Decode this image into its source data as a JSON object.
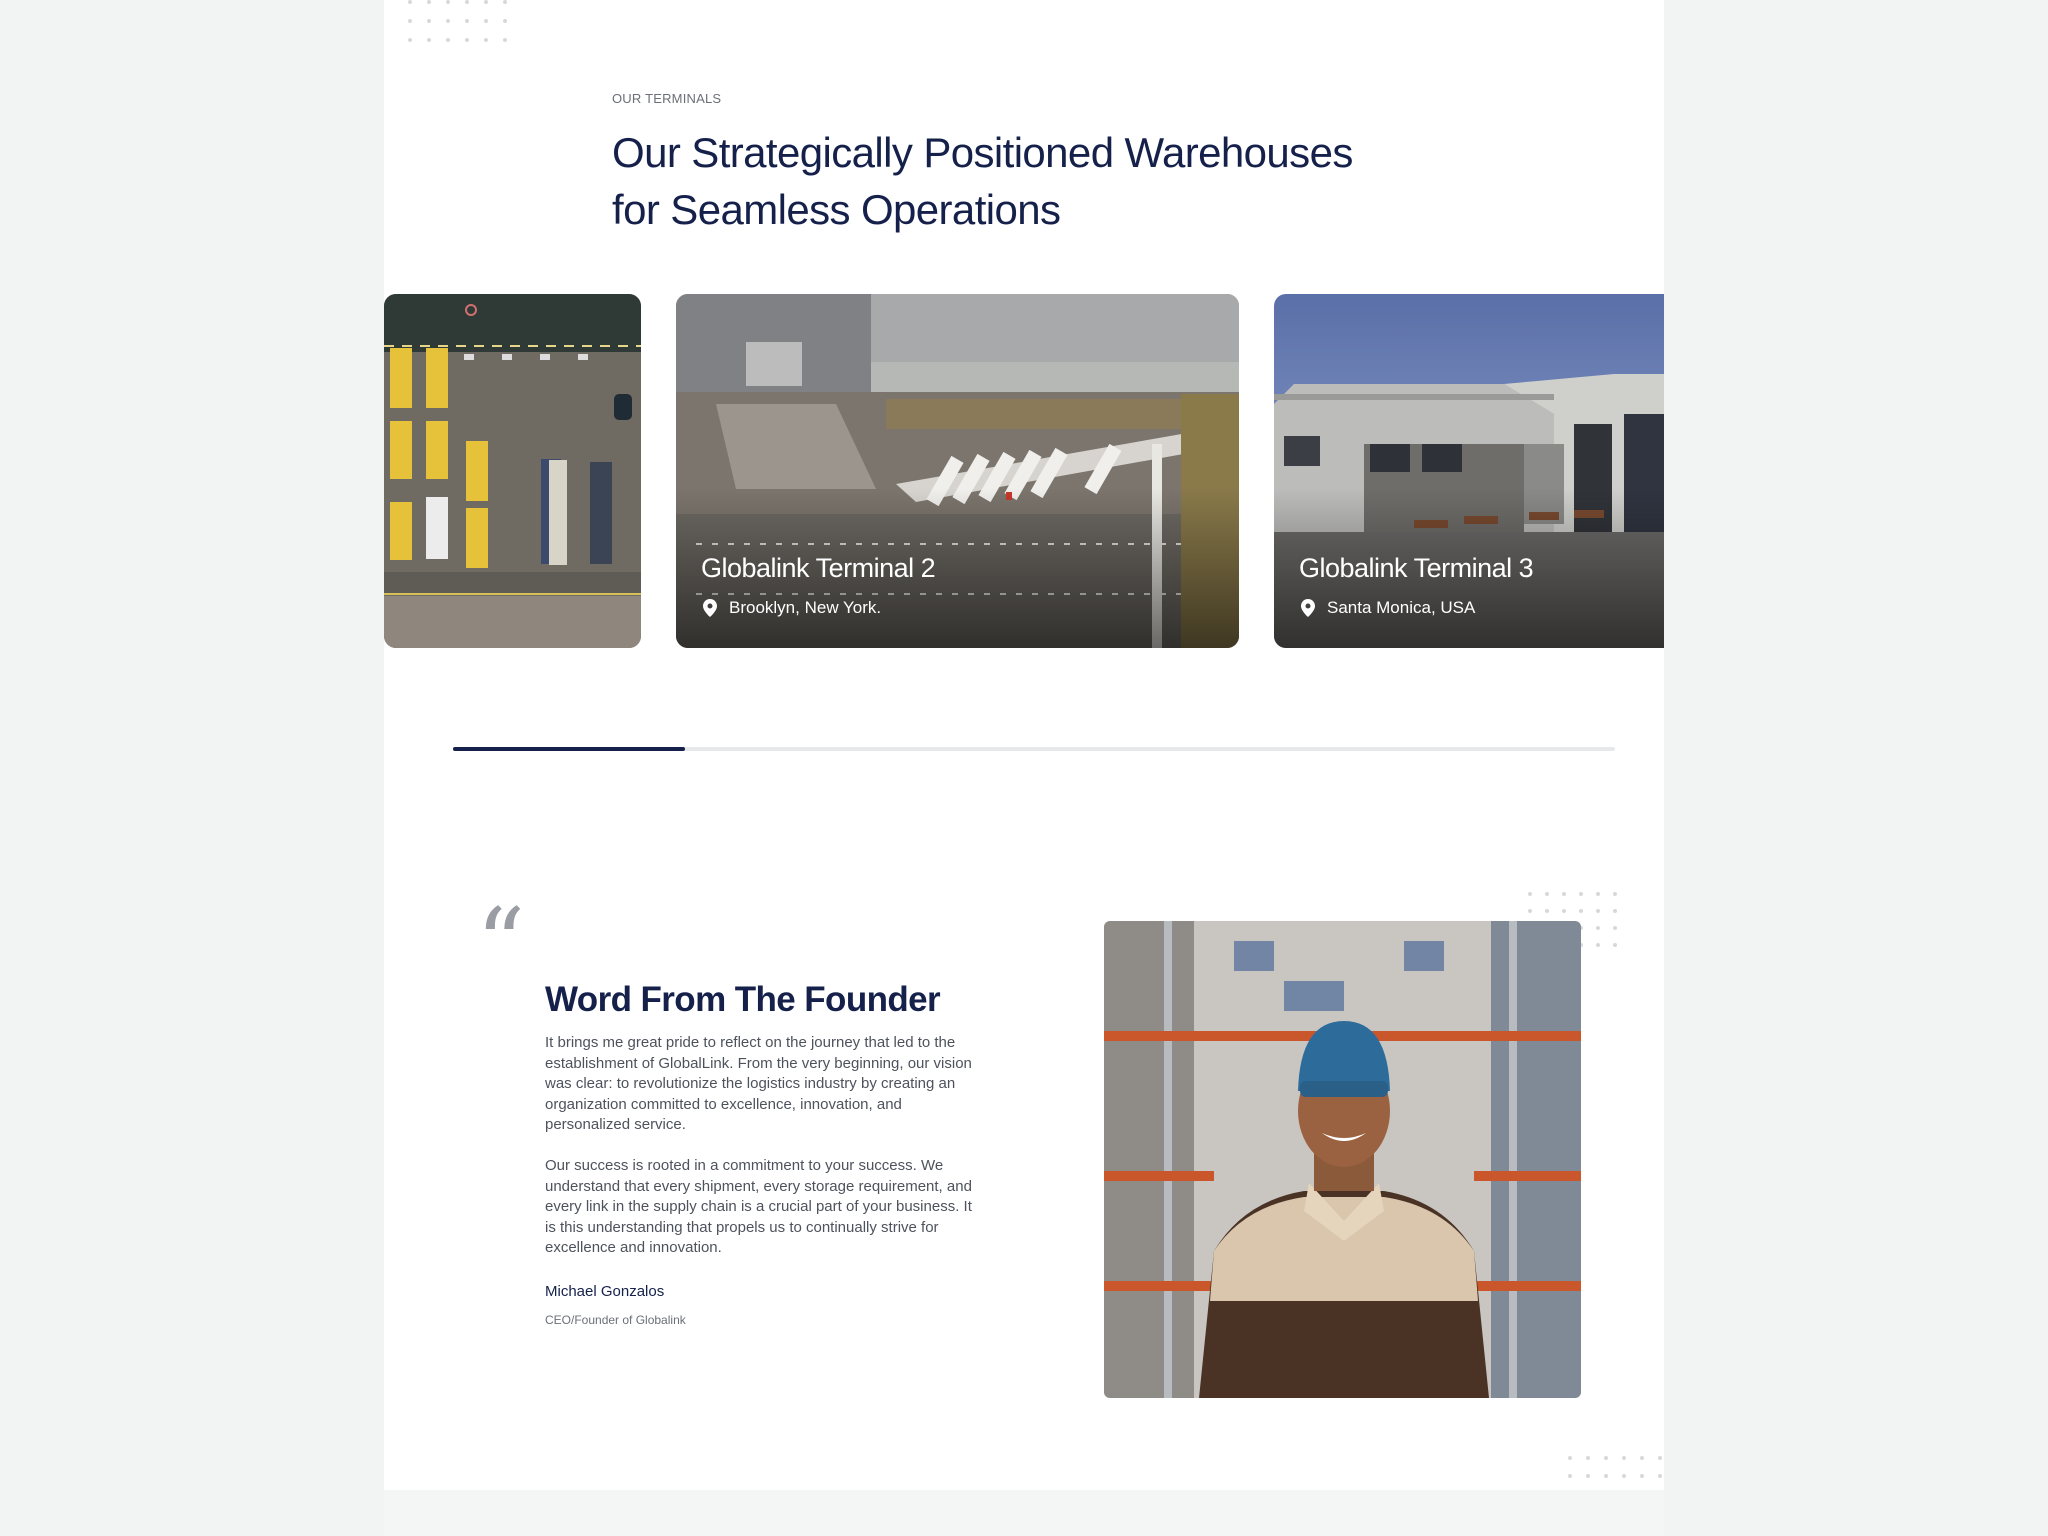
{
  "terminals": {
    "eyebrow": "OUR TERMINALS",
    "title": "Our Strategically Positioned Warehouses for Seamless Operations",
    "cards": [
      {
        "title": "",
        "location": ""
      },
      {
        "title": "Globalink Terminal 2",
        "location": "Brooklyn, New York."
      },
      {
        "title": "Globalink Terminal 3",
        "location": "Santa Monica, USA"
      }
    ],
    "progress": 0.2
  },
  "founder": {
    "quote_icon": "quote-icon",
    "title": "Word From The Founder",
    "paragraph_1": "It brings me great pride to reflect on the journey that led to the establishment of GlobalLink. From the very beginning, our vision was clear: to revolutionize the logistics industry by creating an organization committed to excellence, innovation, and personalized service.",
    "paragraph_2": "Our success is rooted in a commitment to your success. We understand that every shipment, every storage requirement, and every link in the supply chain is a crucial part of your business. It is this understanding that propels us to continually strive for excellence and innovation.",
    "name": "Michael Gonzalos",
    "role": "CEO/Founder of Globalink"
  },
  "colors": {
    "navy": "#15214a",
    "page_bg": "#f2f3f3",
    "track": "#e6e8ea"
  }
}
